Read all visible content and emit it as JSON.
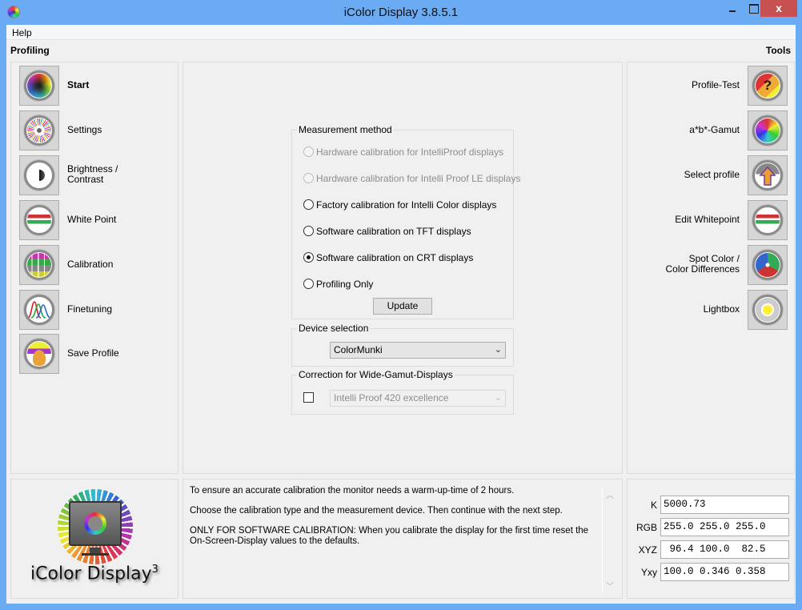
{
  "window": {
    "title": "iColor Display 3.8.5.1",
    "close_glyph": "x"
  },
  "menubar": {
    "items": [
      {
        "label": "Help"
      }
    ]
  },
  "sections": {
    "profiling": "Profiling",
    "tools": "Tools"
  },
  "profiling": {
    "items": [
      {
        "label": "Start",
        "icon": "color-wheel-icon",
        "active": true
      },
      {
        "label": "Settings",
        "icon": "settings-wheel-icon"
      },
      {
        "label": "Brightness /\nContrast",
        "icon": "brightness-contrast-icon"
      },
      {
        "label": "White Point",
        "icon": "white-point-icon"
      },
      {
        "label": "Calibration",
        "icon": "calibration-grid-icon"
      },
      {
        "label": "Finetuning",
        "icon": "spectral-curves-icon"
      },
      {
        "label": "Save Profile",
        "icon": "save-box-icon"
      }
    ]
  },
  "tools": {
    "items": [
      {
        "label": "Profile-Test",
        "icon": "profile-test-icon",
        "glyph": "?"
      },
      {
        "label": "a*b*-Gamut",
        "icon": "gamut-icon"
      },
      {
        "label": "Select profile",
        "icon": "select-profile-icon"
      },
      {
        "label": "Edit Whitepoint",
        "icon": "edit-whitepoint-icon"
      },
      {
        "label": "Spot Color /\nColor Differences",
        "icon": "spot-color-icon"
      },
      {
        "label": "Lightbox",
        "icon": "lightbox-icon"
      }
    ]
  },
  "measurement": {
    "title": "Measurement method",
    "options": [
      {
        "label": "Hardware calibration for IntelliProof displays",
        "enabled": false,
        "checked": false
      },
      {
        "label": "Hardware calibration for Intelli Proof LE displays",
        "enabled": false,
        "checked": false
      },
      {
        "label": "Factory calibration for Intelli Color displays",
        "enabled": true,
        "checked": false
      },
      {
        "label": "Software calibration on TFT displays",
        "enabled": true,
        "checked": false
      },
      {
        "label": "Software calibration on CRT displays",
        "enabled": true,
        "checked": true
      },
      {
        "label": "Profiling Only",
        "enabled": true,
        "checked": false
      }
    ],
    "update_label": "Update"
  },
  "device": {
    "title": "Device selection",
    "selected": "ColorMunki",
    "arrow": "⌄"
  },
  "wide_gamut": {
    "title": "Correction for Wide-Gamut-Displays",
    "checked": false,
    "selected": "Intelli Proof 420 excellence",
    "enabled": false,
    "arrow": "⌄"
  },
  "info": {
    "paragraphs": [
      "To ensure an accurate calibration the monitor needs a warm-up-time of 2 hours.",
      "Choose the calibration type and the measurement device. Then continue with the next step.",
      "ONLY FOR SOFTWARE CALIBRATION: When you calibrate the display for the first time reset the On-Screen-Display values to the defaults."
    ],
    "scroll_up": "︿",
    "scroll_down": "﹀"
  },
  "logo": {
    "text": "iColor Display",
    "superscript": "3"
  },
  "values": {
    "rows": [
      {
        "label": "K",
        "value": "5000.73"
      },
      {
        "label": "RGB",
        "value": "255.0 255.0 255.0"
      },
      {
        "label": "XYZ",
        "value": " 96.4 100.0  82.5"
      },
      {
        "label": "Yxy",
        "value": "100.0 0.346 0.358"
      }
    ]
  },
  "colors": {
    "titlebar": "#6aabf4",
    "close_button": "#c75050",
    "client_bg": "#f0f0f0"
  }
}
